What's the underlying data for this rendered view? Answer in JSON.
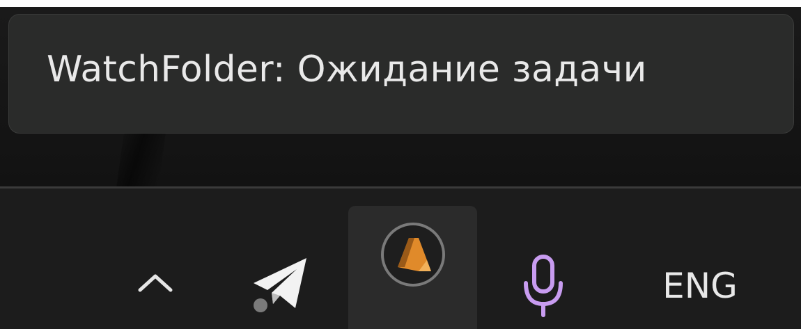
{
  "tooltip": {
    "text": "WatchFolder: Ожидание задачи"
  },
  "tray": {
    "language": "ENG"
  },
  "colors": {
    "tooltip_bg": "#2a2b2a",
    "taskbar_bg": "#1c1c1c",
    "active_item_bg": "#2b2b2b",
    "mic_accent": "#c89cf0",
    "app_icon_orange": "#e08a2a"
  },
  "icons": [
    "chevron-up-icon",
    "telegram-icon",
    "watchfolder-app-icon",
    "microphone-icon"
  ]
}
